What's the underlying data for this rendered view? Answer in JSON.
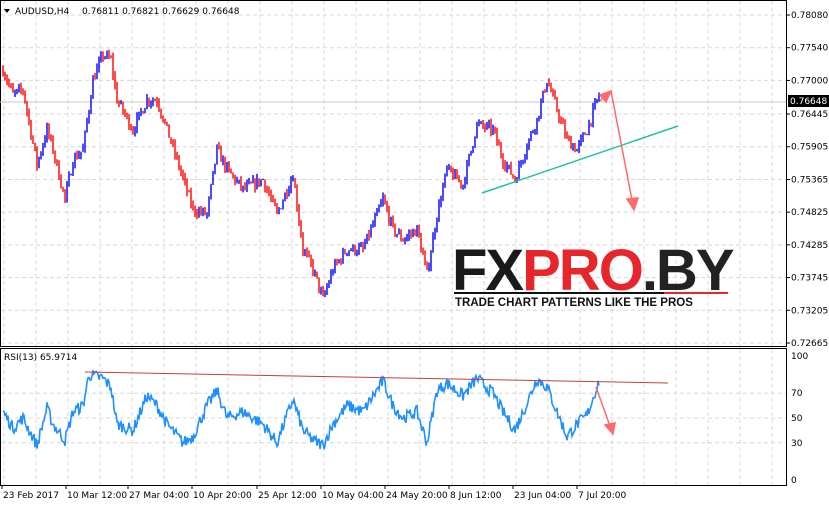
{
  "header": {
    "symbol": "AUDUSD,H4",
    "ohlc": "0.76811 0.76821 0.76629 0.76648"
  },
  "rsi_header": {
    "label": "RSI(13) 65.9714"
  },
  "price_axis": {
    "labels": [
      "0.78080",
      "0.77540",
      "0.77000",
      "0.76445",
      "0.75905",
      "0.75365",
      "0.74825",
      "0.74285",
      "0.73745",
      "0.73205",
      "0.72665"
    ],
    "current_price": "0.76648",
    "min": 0.72665,
    "max": 0.7808
  },
  "rsi_axis": {
    "labels": [
      "100",
      "70",
      "50",
      "30",
      "0"
    ]
  },
  "time_axis": {
    "labels": [
      "23 Feb 2017",
      "10 Mar 12:00",
      "27 Mar 04:00",
      "10 Apr 20:00",
      "25 Apr 12:00",
      "10 May 04:00",
      "24 May 20:00",
      "8 Jun 12:00",
      "23 Jun 04:00",
      "7 Jul 20:00"
    ]
  },
  "logo": {
    "text_black": "FX",
    "text_red": "PRO",
    "text_dark": ".BY",
    "tagline": "TRADE CHART PATTERNS LIKE THE PROS"
  },
  "colors": {
    "bull": "#0000ff",
    "bear": "#ff0000",
    "rsi": "#1e90ff",
    "trendline": "#20c0a0",
    "annotation": "#ff6a6a",
    "rsi_trend": "#c04040"
  },
  "chart_data": {
    "type": "line",
    "title": "AUDUSD,H4",
    "price_path": [
      [
        0,
        0.77175
      ],
      [
        5,
        0.76763
      ],
      [
        10,
        0.76846
      ],
      [
        17,
        0.75611
      ],
      [
        22,
        0.76187
      ],
      [
        25,
        0.75858
      ],
      [
        31,
        0.75035
      ],
      [
        35,
        0.75693
      ],
      [
        40,
        0.75858
      ],
      [
        45,
        0.7701
      ],
      [
        50,
        0.77422
      ],
      [
        54,
        0.77339
      ],
      [
        57,
        0.76681
      ],
      [
        65,
        0.76187
      ],
      [
        72,
        0.76681
      ],
      [
        77,
        0.76681
      ],
      [
        82,
        0.76187
      ],
      [
        95,
        0.7487
      ],
      [
        102,
        0.74788
      ],
      [
        107,
        0.75858
      ],
      [
        112,
        0.75529
      ],
      [
        120,
        0.752
      ],
      [
        130,
        0.75364
      ],
      [
        137,
        0.74788
      ],
      [
        145,
        0.75446
      ],
      [
        150,
        0.74212
      ],
      [
        155,
        0.73883
      ],
      [
        160,
        0.73389
      ],
      [
        165,
        0.73883
      ],
      [
        172,
        0.74212
      ],
      [
        180,
        0.74212
      ],
      [
        190,
        0.75035
      ],
      [
        195,
        0.74541
      ],
      [
        200,
        0.74376
      ],
      [
        207,
        0.74541
      ],
      [
        212,
        0.73801
      ],
      [
        217,
        0.74788
      ],
      [
        222,
        0.75529
      ],
      [
        230,
        0.75282
      ],
      [
        237,
        0.7627
      ],
      [
        245,
        0.76187
      ],
      [
        250,
        0.75693
      ],
      [
        256,
        0.75364
      ],
      [
        262,
        0.7594
      ],
      [
        267,
        0.76352
      ],
      [
        272,
        0.7701
      ],
      [
        277,
        0.76516
      ],
      [
        282,
        0.76023
      ],
      [
        287,
        0.75858
      ],
      [
        292,
        0.76187
      ],
      [
        298,
        0.76763
      ]
    ],
    "rsi_path": [
      [
        0,
        55
      ],
      [
        5,
        42
      ],
      [
        10,
        50
      ],
      [
        17,
        28
      ],
      [
        22,
        58
      ],
      [
        25,
        45
      ],
      [
        31,
        32
      ],
      [
        35,
        55
      ],
      [
        40,
        60
      ],
      [
        43,
        85
      ],
      [
        50,
        82
      ],
      [
        54,
        75
      ],
      [
        57,
        45
      ],
      [
        65,
        40
      ],
      [
        72,
        68
      ],
      [
        77,
        60
      ],
      [
        82,
        45
      ],
      [
        90,
        30
      ],
      [
        95,
        35
      ],
      [
        102,
        60
      ],
      [
        107,
        72
      ],
      [
        112,
        50
      ],
      [
        120,
        55
      ],
      [
        130,
        45
      ],
      [
        137,
        30
      ],
      [
        145,
        65
      ],
      [
        150,
        40
      ],
      [
        155,
        32
      ],
      [
        160,
        28
      ],
      [
        165,
        45
      ],
      [
        172,
        60
      ],
      [
        180,
        55
      ],
      [
        190,
        80
      ],
      [
        195,
        60
      ],
      [
        200,
        50
      ],
      [
        207,
        55
      ],
      [
        212,
        30
      ],
      [
        217,
        72
      ],
      [
        222,
        78
      ],
      [
        230,
        68
      ],
      [
        237,
        82
      ],
      [
        245,
        70
      ],
      [
        250,
        55
      ],
      [
        256,
        40
      ],
      [
        262,
        62
      ],
      [
        267,
        82
      ],
      [
        272,
        75
      ],
      [
        277,
        55
      ],
      [
        282,
        35
      ],
      [
        287,
        45
      ],
      [
        292,
        52
      ],
      [
        298,
        80
      ]
    ],
    "rsi_ylim": [
      0,
      100
    ],
    "ylim": [
      0.72665,
      0.7808
    ]
  }
}
